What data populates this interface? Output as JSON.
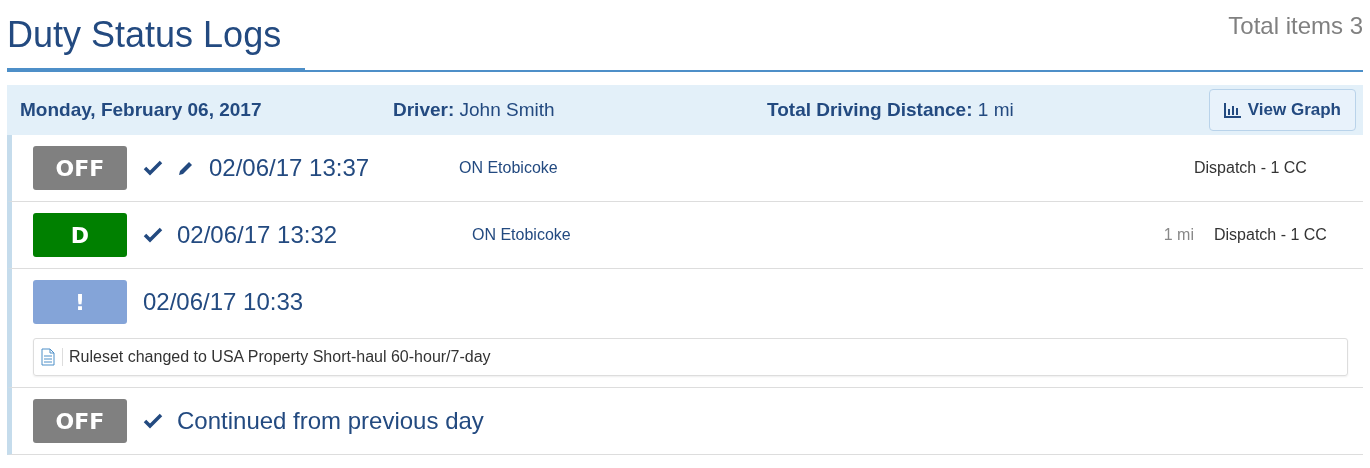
{
  "title": "Duty Status Logs",
  "total_items": "Total items 3",
  "day": {
    "date": "Monday, February 06, 2017",
    "driver_label": "Driver:",
    "driver": "John Smith",
    "distance_label": "Total Driving Distance:",
    "distance": "1 mi",
    "view_graph": "View Graph"
  },
  "logs": [
    {
      "status": "OFF",
      "color": "#808080",
      "verified": true,
      "edited": true,
      "time": "02/06/17 13:37",
      "location": "ON Etobicoke",
      "origin": "Dispatch - 1 CC"
    },
    {
      "status": "D",
      "color": "#008000",
      "verified": true,
      "edited": false,
      "time": "02/06/17 13:32",
      "location": "ON Etobicoke",
      "distance": "1 mi",
      "origin": "Dispatch - 1 CC"
    },
    {
      "status": "!",
      "color": "#84a4d8",
      "verified": false,
      "edited": false,
      "time": "02/06/17 10:33",
      "note": "Ruleset changed to USA Property Short-haul 60-hour/7-day"
    },
    {
      "status": "OFF",
      "color": "#808080",
      "verified": true,
      "edited": false,
      "time": "Continued from previous day"
    }
  ]
}
